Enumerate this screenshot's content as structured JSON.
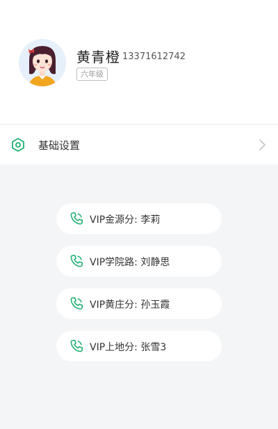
{
  "profile": {
    "name": "黄青橙",
    "phone": "13371612742",
    "grade": "六年级"
  },
  "settings": {
    "label": "基础设置"
  },
  "contacts": [
    {
      "label": "VIP金源分: 李莉"
    },
    {
      "label": "VIP学院路: 刘静思"
    },
    {
      "label": "VIP黄庄分: 孙玉霞"
    },
    {
      "label": "VIP上地分: 张雪3"
    }
  ],
  "colors": {
    "accent_green": "#1fae6f",
    "background": "#f4f5f7"
  },
  "icons": [
    "avatar-girl",
    "gear-icon",
    "chevron-right-icon",
    "phone-icon"
  ]
}
